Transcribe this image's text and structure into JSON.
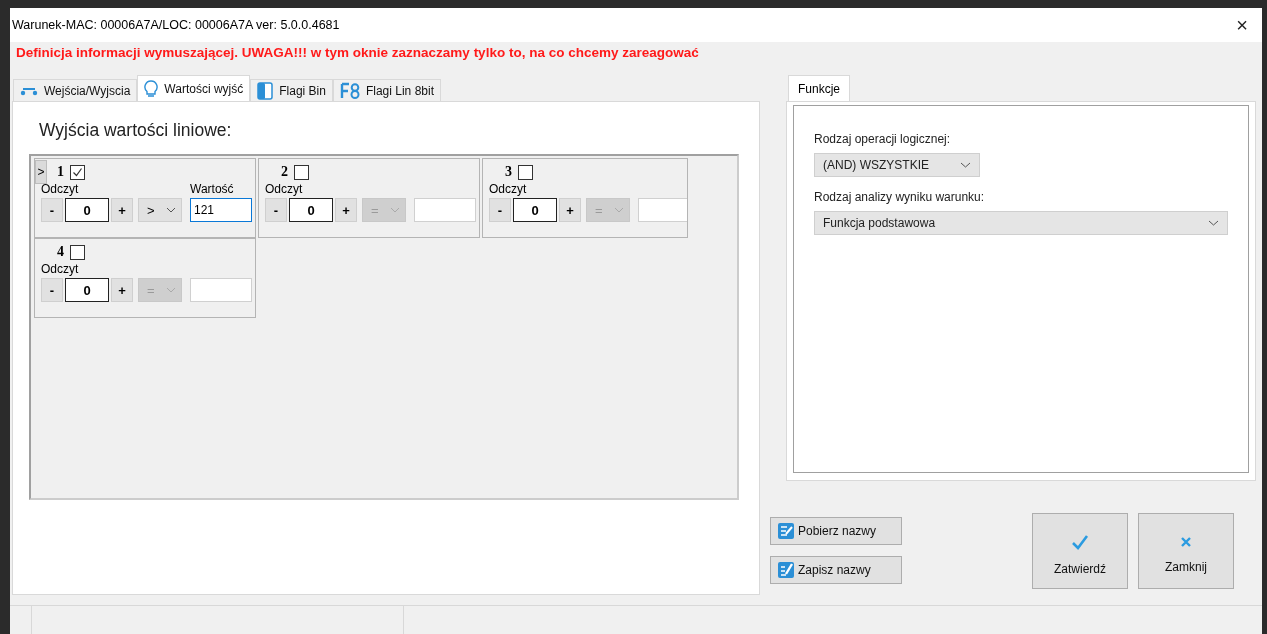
{
  "window": {
    "title": "Warunek-MAC: 00006A7A/LOC: 00006A7A ver: 5.0.0.4681",
    "close": "×"
  },
  "warning": "Definicja informacji wymuszającej. UWAGA!!! w tym oknie zaznaczamy tylko to, na co chcemy zareagować",
  "tabs": [
    {
      "label": "Wejścia/Wyjscia",
      "selected": false
    },
    {
      "label": "Wartości wyjść",
      "selected": true
    },
    {
      "label": "Flagi Bin",
      "selected": false
    },
    {
      "label": "Flagi Lin 8bit",
      "selected": false
    }
  ],
  "panel_title": "Wyjścia wartości liniowe:",
  "expand_button": ">",
  "outputs": [
    {
      "number": "1",
      "checked": true,
      "reading_label": "Odczyt",
      "minus": "-",
      "reading": "0",
      "plus": "+",
      "operator": ">",
      "operator_disabled": false,
      "value_label": "Wartość",
      "value": "121",
      "value_focused": true
    },
    {
      "number": "2",
      "checked": false,
      "reading_label": "Odczyt",
      "minus": "-",
      "reading": "0",
      "plus": "+",
      "operator": "=",
      "operator_disabled": true,
      "value_focused": false
    },
    {
      "number": "3",
      "checked": false,
      "reading_label": "Odczyt",
      "minus": "-",
      "reading": "0",
      "plus": "+",
      "operator": "=",
      "operator_disabled": true,
      "value_focused": false
    },
    {
      "number": "4",
      "checked": false,
      "reading_label": "Odczyt",
      "minus": "-",
      "reading": "0",
      "plus": "+",
      "operator": "=",
      "operator_disabled": true,
      "value_focused": false
    }
  ],
  "functions_tab": {
    "label": "Funkcje",
    "selected": true
  },
  "logic_label": "Rodzaj operacji logicznej:",
  "logic_value": "(AND) WSZYSTKIE",
  "analysis_label": "Rodzaj analizy wyniku warunku:",
  "analysis_value": "Funkcja podstawowa",
  "name_buttons": [
    {
      "label": "Pobierz nazwy"
    },
    {
      "label": "Zapisz nazwy"
    }
  ],
  "action_buttons": [
    {
      "label": "Zatwierdź"
    },
    {
      "label": "Zamknij"
    }
  ]
}
